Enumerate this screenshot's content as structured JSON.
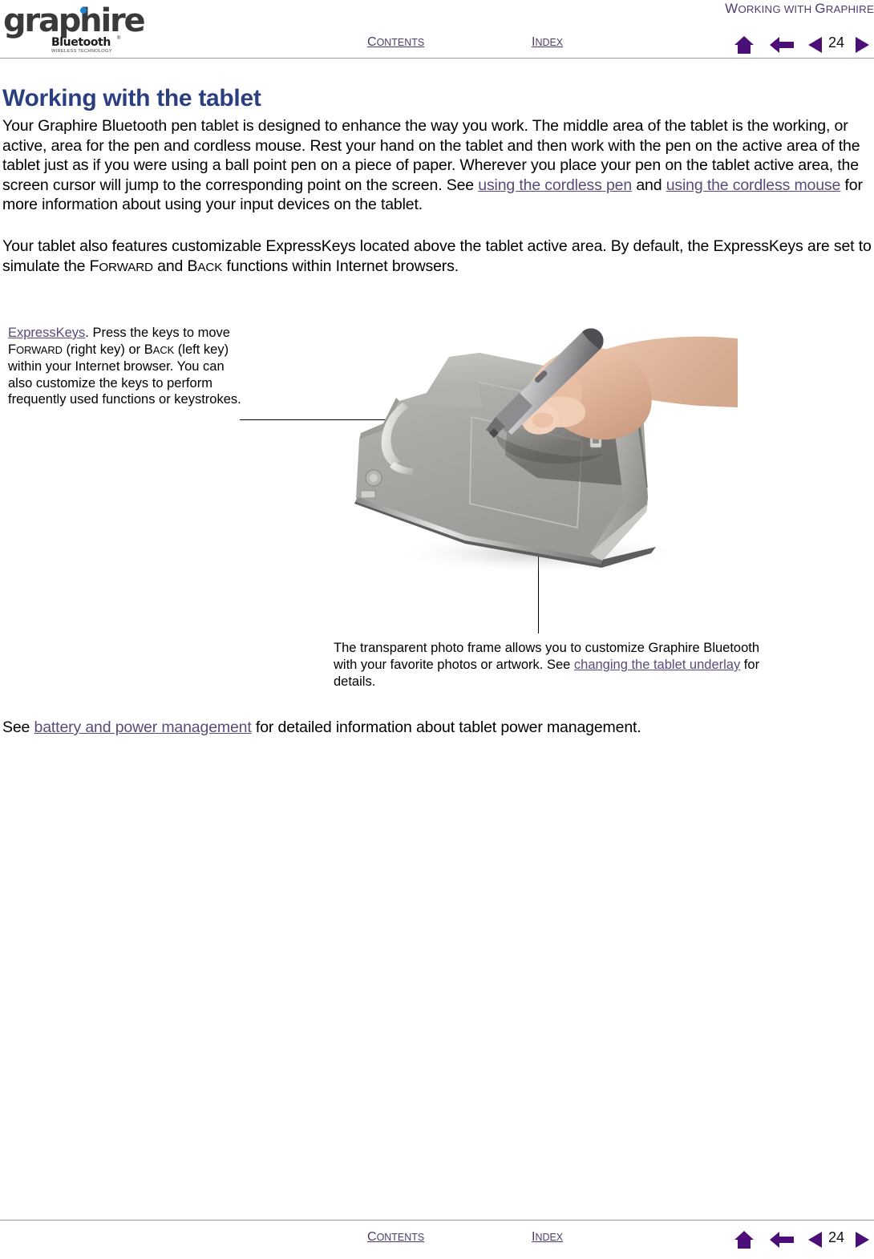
{
  "document": {
    "logo": {
      "wordmark": "graphire",
      "registered": "®",
      "sub_brand": "Bluetooth",
      "trademark": "®",
      "tagline": "WIRELESS TECHNOLOGY",
      "dot_color": "#1a84d6",
      "wordmark_color": "#3a3a3a"
    },
    "header": {
      "section_title_lead": "W",
      "section_title_rest": "orking with ",
      "section_title_lead2": "G",
      "section_title_rest2": "raphire",
      "section_title_full": "WORKING WITH GRAPHIRE"
    },
    "nav": {
      "contents_lead": "C",
      "contents_rest": "ontents",
      "index_lead": "I",
      "index_rest": "ndex",
      "page_number": "24",
      "home_icon": "home-icon",
      "back_icon": "back-arrow-icon",
      "prev_icon": "previous-page-icon",
      "next_icon": "next-page-icon",
      "accent_color": "#4d3b6e"
    },
    "main": {
      "title": "Working with the tablet",
      "title_color": "#2b3f80",
      "paragraph_1": {
        "text_1": "Your Graphire Bluetooth pen tablet is designed to enhance the way you work.  The middle area of the tablet is the working, or active, area for the pen and cordless mouse.  Rest your hand on the tablet and then work with the pen on the active area of the tablet just as if you were using a ball point pen on a piece of paper.  Wherever you place your pen on the tablet active area, the screen cursor will jump to the corresponding point on the screen.  See ",
        "link_1": "using the cordless pen",
        "text_2": " and ",
        "link_2": "using the cordless mouse",
        "text_3": " for more information about using your input devices on the tablet."
      },
      "paragraph_2": {
        "text_1": "Your tablet also features customizable ExpressKeys located above the tablet active area.  By default, the ExpressKeys are set to simulate the ",
        "smallcaps_1_lead": "F",
        "smallcaps_1_rest": "orward",
        "text_2": " and ",
        "smallcaps_2_lead": "B",
        "smallcaps_2_rest": "ack",
        "text_3": " functions within Internet browsers."
      },
      "paragraph_3": {
        "text_1": "See ",
        "link_1": "battery and power management",
        "text_2": " for detailed information about tablet power management."
      }
    },
    "figure": {
      "callout_left": {
        "link": "ExpressKeys",
        "text_1": ".  Press the keys to move ",
        "smallcaps_1_lead": "F",
        "smallcaps_1_rest": "orward",
        "text_2": " (right key) or ",
        "smallcaps_2_lead": "B",
        "smallcaps_2_rest": "ack",
        "text_3": " (left key) within your Internet browser.  You can also customize the keys to perform frequently used functions or keystrokes."
      },
      "callout_bottom": {
        "text_1": "The transparent photo frame allows you to customize Graphire Bluetooth with your favorite photos or artwork. See ",
        "link_1": "changing the tablet underlay",
        "text_2": " for details."
      },
      "photo_alt": "Graphire Bluetooth tablet viewed at an angle with a hand holding the cordless pen on the active area"
    },
    "footer": {
      "contents_lead": "C",
      "contents_rest": "ontents",
      "index_lead": "I",
      "index_rest": "ndex",
      "page_number": "24"
    }
  }
}
